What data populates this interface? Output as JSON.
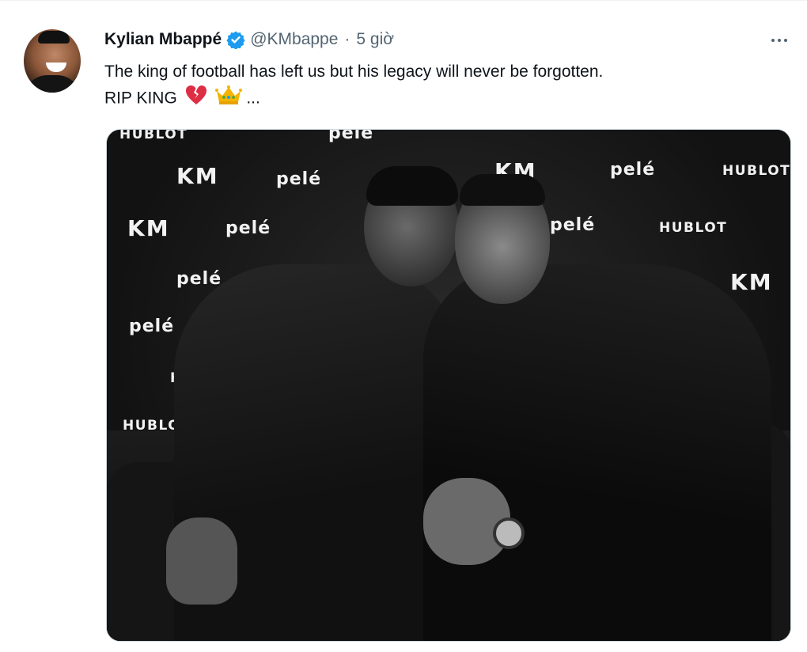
{
  "tweet": {
    "author_name": "Kylian Mbappé",
    "handle": "@KMbappe",
    "separator": "·",
    "time": "5 giờ",
    "text_line1": "The king of football has left us but his legacy will never be forgotten.",
    "text_line2": "RIP KING",
    "ellipsis": "...",
    "emojis": [
      "broken-heart",
      "crown"
    ],
    "verified_color": "#1d9bf0"
  },
  "media": {
    "backdrop_logos": {
      "km": "KM",
      "pele": "pelé",
      "hublot": "HUBLOT"
    }
  }
}
